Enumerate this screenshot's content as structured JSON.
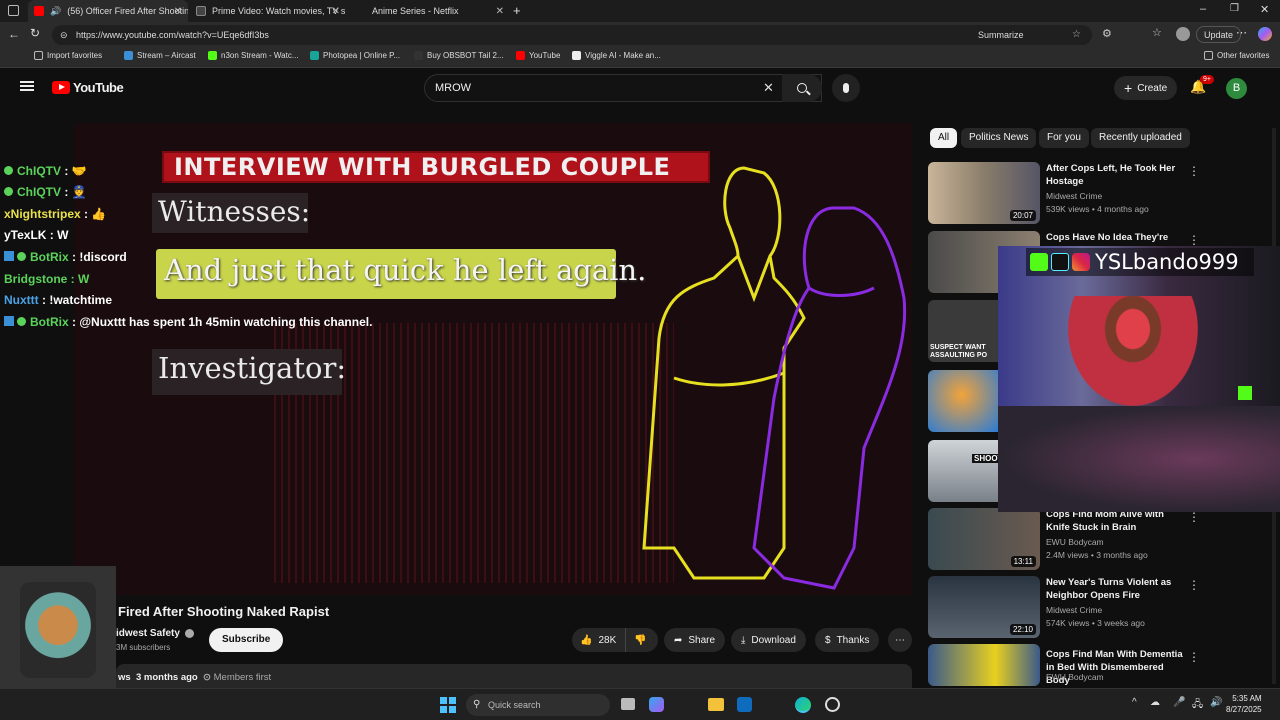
{
  "browser": {
    "tabs": [
      {
        "label": "(56) Officer Fired After Shooting"
      },
      {
        "label": "Prime Video: Watch movies, TV sh"
      },
      {
        "label": "Anime Series - Netflix"
      }
    ],
    "url": "https://www.youtube.com/watch?v=UEqe6dfI3bs",
    "summarize": "Summarize",
    "update": "Update",
    "bookmarks": [
      "Import favorites",
      "Stream – Aircast",
      "n3on Stream - Watc...",
      "Photopea | Online P...",
      "Buy OBSBOT Tail 2...",
      "YouTube",
      "Viggle AI - Make an..."
    ],
    "other_favorites": "Other favorites"
  },
  "youtube": {
    "logo": "YouTube",
    "search_value": "MROW",
    "create": "Create",
    "notif_badge": "9+",
    "avatar": "B"
  },
  "video_overlay": {
    "banner": "INTERVIEW WITH BURGLED COUPLE",
    "witnesses": "Witnesses:",
    "caption": "And just that quick he left again.",
    "investigator": "Investigator:"
  },
  "chat": [
    {
      "user": "ChIQTV",
      "msg": " : 🤝",
      "color": "#5bd35b",
      "badge": "check"
    },
    {
      "user": "ChIQTV",
      "msg": " : 👮",
      "color": "#5bd35b",
      "badge": "check"
    },
    {
      "user": "xNightstripex",
      "msg": " : 👍",
      "color": "#e8e04a",
      "badge": ""
    },
    {
      "user": "yTexLK",
      "msg": " : W",
      "color": "#ffffff",
      "badge": ""
    },
    {
      "user": "BotRix",
      "msg": " : !discord",
      "color": "#5bd35b",
      "badge": "bot"
    },
    {
      "user": "Bridgstone",
      "msg": " : W",
      "color": "#5bd35b",
      "badge": ""
    },
    {
      "user": "Nuxttt",
      "msg": " : !watchtime",
      "color": "#4aa3e8",
      "badge": ""
    },
    {
      "user": "BotRix",
      "msg": " : @Nuxttt has spent 1h 45min watching this channel.",
      "color": "#5bd35b",
      "badge": "bot"
    }
  ],
  "streamer": {
    "name": "YSLbando999"
  },
  "video_info": {
    "title": "Fired After Shooting Naked Rapist",
    "channel": "idwest Safety",
    "subs": "3M subscribers",
    "subscribe": "Subscribe",
    "likes": "28K",
    "share": "Share",
    "download": "Download",
    "thanks": "Thanks",
    "meta_views": "ws",
    "meta_date": "3 months ago",
    "members": "Members first"
  },
  "chips": [
    "All",
    "Politics News",
    "For you",
    "Recently uploaded"
  ],
  "recommendations": [
    {
      "title": "After Cops Left, He Took Her Hostage",
      "channel": "Midwest Crime",
      "meta": "539K views • 4 months ago",
      "duration": "20:07"
    },
    {
      "title": "Cops Have No Idea They're",
      "channel": "",
      "meta": "",
      "duration": ""
    },
    {
      "title": "",
      "channel": "",
      "meta": "",
      "duration": "",
      "thumb_text": "SUSPECT WANT ASSAULTING PO"
    },
    {
      "title": "",
      "channel": "",
      "meta": "",
      "duration": ""
    },
    {
      "title": "",
      "channel": "",
      "meta": "",
      "duration": "",
      "thumb_text": "SHOOT"
    },
    {
      "title": "Cops Find Mom Alive with Knife Stuck in Brain",
      "channel": "EWU Bodycam",
      "meta": "2.4M views • 3 months ago",
      "duration": "13:11"
    },
    {
      "title": "New Year's Turns Violent as Neighbor Opens Fire",
      "channel": "Midwest Crime",
      "meta": "574K views • 3 weeks ago",
      "duration": "22:10"
    },
    {
      "title": "Cops Find Man With Dementia in Bed With Dismembered Body",
      "channel": "EWU Bodycam",
      "meta": "",
      "duration": ""
    }
  ],
  "taskbar": {
    "search_placeholder": "Quick search",
    "time": "5:35 AM",
    "date": "8/27/2025"
  },
  "colors": {
    "yt_red": "#ff0000",
    "banner_red": "#b0121c",
    "caption_green": "#c8d44a",
    "outline_yellow": "#e6e020",
    "outline_purple": "#8a2be2"
  }
}
